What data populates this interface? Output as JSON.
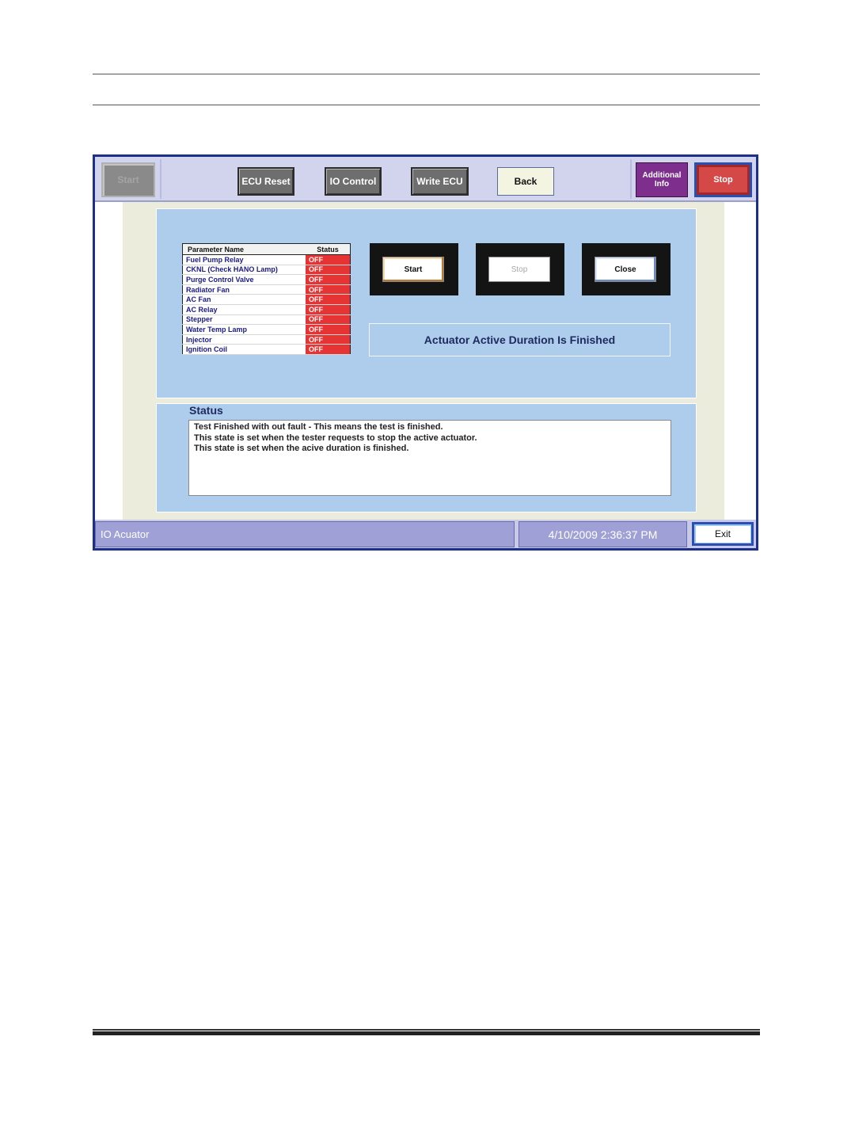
{
  "toolbar": {
    "start_label": "Start",
    "ecu_reset_label": "ECU Reset",
    "io_control_label": "IO Control",
    "write_ecu_label": "Write ECU",
    "back_label": "Back",
    "additional_info_line1": "Additional",
    "additional_info_line2": "Info",
    "stop_label": "Stop"
  },
  "parameter_table": {
    "headers": [
      "Parameter Name",
      "Status"
    ],
    "rows": [
      {
        "name": "Fuel Pump Relay",
        "status": "OFF"
      },
      {
        "name": "CKNL (Check HANO Lamp)",
        "status": "OFF"
      },
      {
        "name": "Purge Control Valve",
        "status": "OFF"
      },
      {
        "name": "Radiator Fan",
        "status": "OFF"
      },
      {
        "name": "AC  Fan",
        "status": "OFF"
      },
      {
        "name": "AC Relay",
        "status": "OFF"
      },
      {
        "name": "Stepper",
        "status": "OFF"
      },
      {
        "name": "Water Temp Lamp",
        "status": "OFF"
      },
      {
        "name": "Injector",
        "status": "OFF"
      },
      {
        "name": "Ignition Coil",
        "status": "OFF"
      }
    ]
  },
  "controls": {
    "start_label": "Start",
    "stop_label": "Stop",
    "close_label": "Close"
  },
  "message": "Actuator Active Duration Is Finished",
  "status_panel": {
    "title": "Status",
    "lines": [
      "Test Finished with out fault - This means the test is finished.",
      "This state is set when the tester requests to stop the active actuator.",
      "This state is set when the acive duration is finished."
    ]
  },
  "statusbar": {
    "screen_name": "IO Acuator",
    "datetime": "4/10/2009 2:36:37 PM",
    "exit_label": "Exit"
  },
  "colors": {
    "status_off": "#e63434",
    "panel_blue": "#aecdec",
    "additional_info": "#7e2f8e",
    "stop_red": "#d44848"
  }
}
